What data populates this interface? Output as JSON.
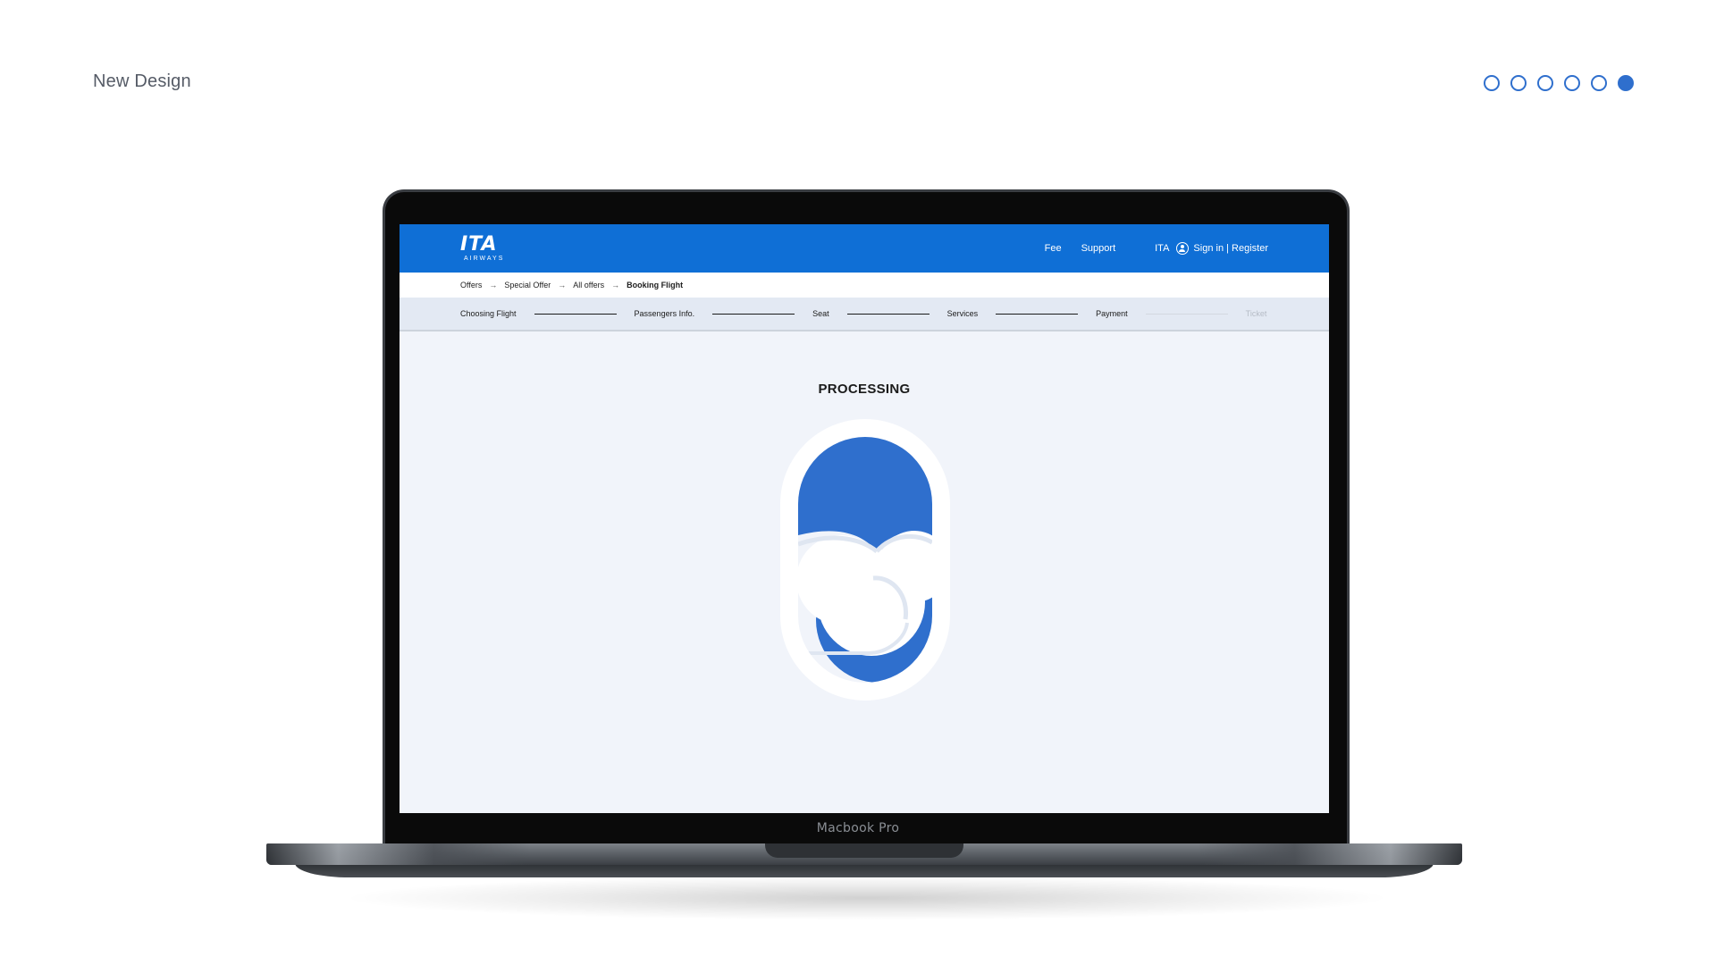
{
  "slide": {
    "title": "New Design",
    "pager": {
      "total": 6,
      "active_index": 5
    }
  },
  "device": {
    "label": "Macbook Pro"
  },
  "app": {
    "logo": {
      "mark": "ITA",
      "sub": "AIRWAYS"
    },
    "nav": {
      "fee": "Fee",
      "support": "Support",
      "language": "ITA",
      "sign_in": "Sign in | Register"
    },
    "breadcrumb": [
      "Offers",
      "Special Offer",
      "All offers",
      "Booking Flight"
    ],
    "steps": [
      "Choosing Flight",
      "Passengers Info.",
      "Seat",
      "Services",
      "Payment",
      "Ticket"
    ],
    "status": "PROCESSING"
  },
  "colors": {
    "brand_blue": "#0f6fd6",
    "accent_blue": "#2f6fcd",
    "screen_bg": "#f1f4fa"
  }
}
